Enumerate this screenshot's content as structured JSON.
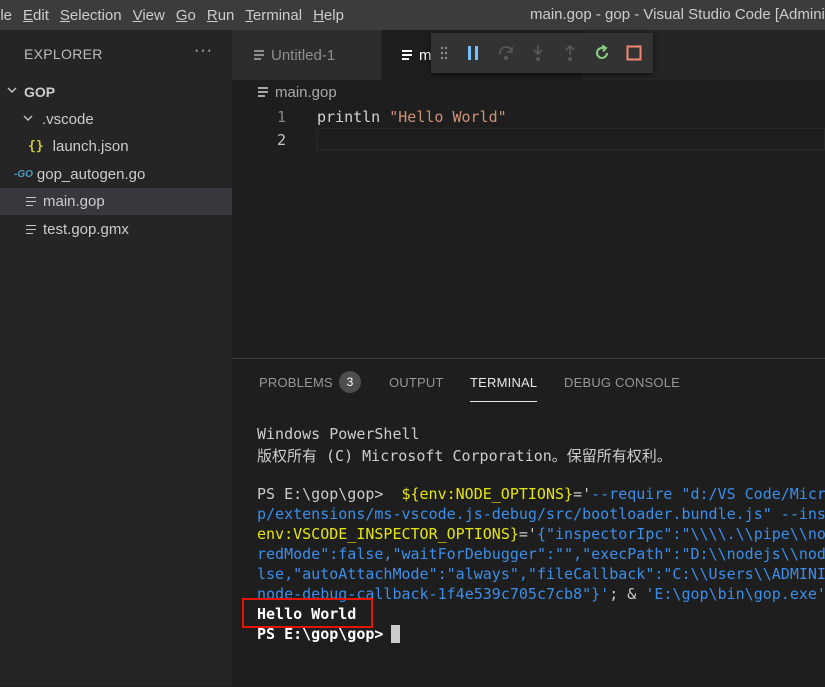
{
  "menu": {
    "items": [
      "ile",
      "Edit",
      "Selection",
      "View",
      "Go",
      "Run",
      "Terminal",
      "Help"
    ],
    "underlined_first": [
      "",
      "E",
      "S",
      "V",
      "G",
      "R",
      "T",
      "H"
    ]
  },
  "window_title": "main.gop - gop - Visual Studio Code [Admini",
  "sidebar": {
    "header": "EXPLORER",
    "more": "···",
    "folder": "GOP",
    "items": [
      {
        "label": ".vscode",
        "icon": "chevron-down-icon"
      },
      {
        "label": "launch.json",
        "icon": "json-icon",
        "icon_text": "{}"
      },
      {
        "label": "gop_autogen.go",
        "icon": "go-file-icon",
        "icon_text": "-GO"
      },
      {
        "label": "main.gop",
        "icon": "lines-file-icon"
      },
      {
        "label": "test.gop.gmx",
        "icon": "lines-file-icon"
      }
    ]
  },
  "tabs": [
    {
      "label": "Untitled-1"
    },
    {
      "label": "m"
    }
  ],
  "editor": {
    "breadcrumb": "main.gop",
    "lines": [
      {
        "number": "1",
        "keyword": "println ",
        "string": "\"Hello World\""
      },
      {
        "number": "2",
        "keyword": "",
        "string": ""
      }
    ]
  },
  "panel": {
    "tabs": [
      "PROBLEMS",
      "OUTPUT",
      "TERMINAL",
      "DEBUG CONSOLE"
    ],
    "problems_count": "3",
    "active_tab": "TERMINAL"
  },
  "terminal": {
    "line1": "Windows PowerShell",
    "line2": "版权所有 (C) Microsoft Corporation。保留所有权利。",
    "prompt1": "PS E:\\gop\\gop> ",
    "cmd_a_var": "${env:NODE_OPTIONS}",
    "cmd_a_eq": "='",
    "cmd_a_str": "--require \"d:/VS Code/Micr",
    "cmd_b": "p/extensions/ms-vscode.js-debug/src/bootloader.bundle.js\" --ins",
    "cmd_c_var": "env:VSCODE_INSPECTOR_OPTIONS}",
    "cmd_c_eq": "='",
    "cmd_c_str": "{\"inspectorIpc\":\"\\\\\\\\.\\\\pipe\\\\nod",
    "cmd_d": "redMode\":false,\"waitForDebugger\":\"\",\"execPath\":\"D:\\\\nodejs\\\\nod",
    "cmd_e": "lse,\"autoAttachMode\":\"always\",\"fileCallback\":\"C:\\\\Users\\\\ADMINI",
    "cmd_f_str": "node-debug-callback-1f4e539c705c7cb8\"}'",
    "cmd_f_rest": "; & ",
    "cmd_f_exe": "'E:\\gop\\bin\\gop.exe'",
    "output": "Hello World",
    "prompt2": "PS E:\\gop\\gop>"
  },
  "colors": {
    "accent_red_box": "#e51400",
    "string": "#ce9178",
    "terminal_yellow": "#e5e510",
    "terminal_blue": "#3b8eea"
  }
}
